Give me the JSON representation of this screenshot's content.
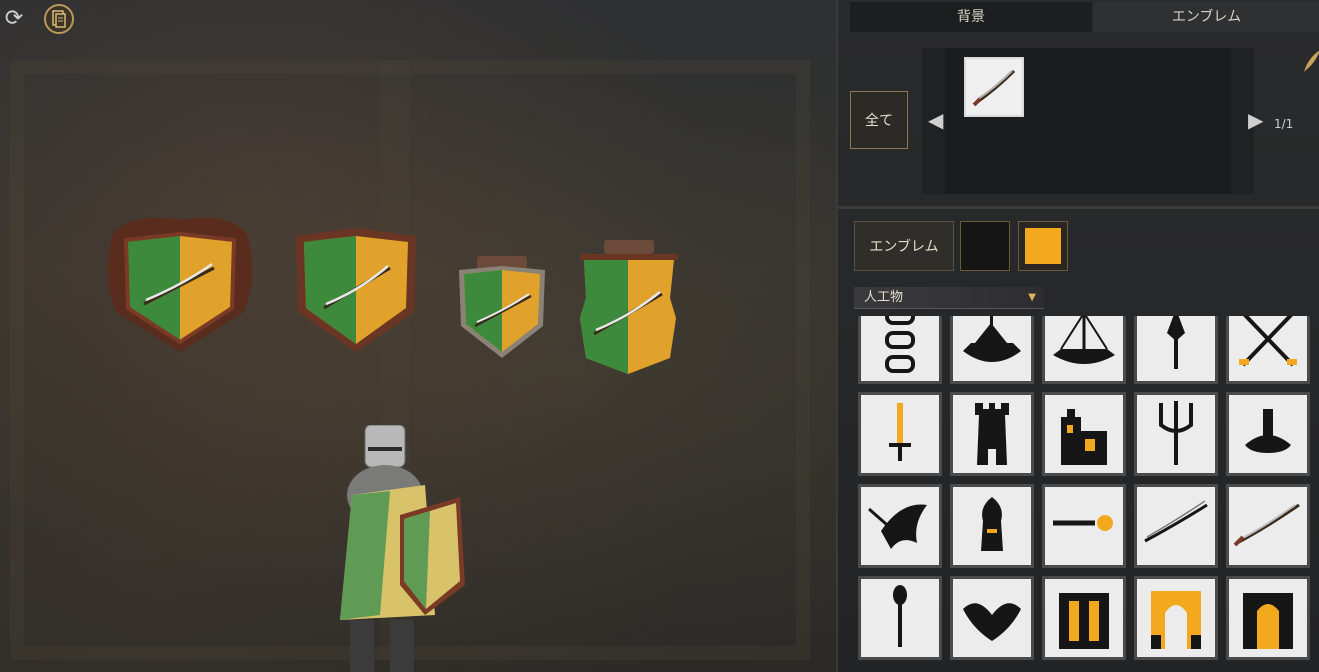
{
  "tabs": {
    "background": "背景",
    "emblem": "エンブレム"
  },
  "recent": {
    "all_label": "全て",
    "page_indicator": "1/1"
  },
  "emblem_color": {
    "label": "エンブレム",
    "primary": "#161616",
    "secondary": "#f3a91e"
  },
  "category": {
    "selected": "人工物"
  },
  "colors": {
    "shield_left": "#3e8a3c",
    "shield_right": "#e0a22a",
    "shield_rim": "#6b3524",
    "panel_bg": "#262728"
  },
  "icons": [
    "chain-links-icon",
    "longship-with-flag-icon",
    "viking-ship-icon",
    "spearhead-icon",
    "crossed-swords-icon",
    "sword-icon",
    "tower-icon",
    "castle-icon",
    "trident-icon",
    "anvil-icon",
    "arrow-wing-icon",
    "helmet-crest-icon",
    "key-icon",
    "katana-icon",
    "curved-blade-icon",
    "mace-icon",
    "double-headed-eagle-icon",
    "gate-icon",
    "arch-gate-icon",
    "banner-gate-icon"
  ]
}
